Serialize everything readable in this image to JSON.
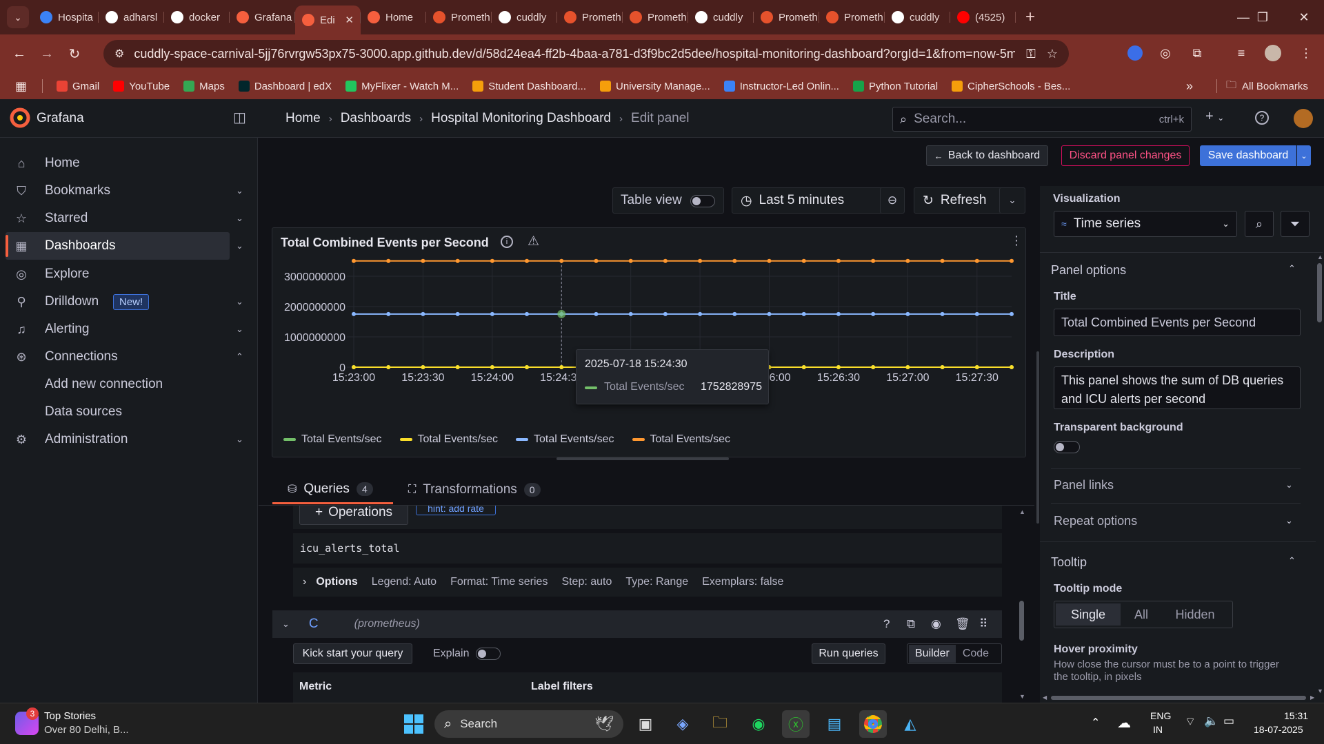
{
  "browser": {
    "tabs": [
      {
        "label": "Hospita",
        "icon": "k-icon",
        "color": "#3b82f6"
      },
      {
        "label": "adharsl",
        "icon": "github-icon",
        "color": "#ffffff"
      },
      {
        "label": "docker",
        "icon": "github-icon",
        "color": "#ffffff"
      },
      {
        "label": "Grafana",
        "icon": "grafana-icon",
        "color": "#f55f3e"
      },
      {
        "label": "Edi",
        "icon": "grafana-icon",
        "color": "#f55f3e",
        "active": true
      },
      {
        "label": "Home",
        "icon": "grafana-icon",
        "color": "#f55f3e"
      },
      {
        "label": "Prometh",
        "icon": "prometheus-icon",
        "color": "#e6522c"
      },
      {
        "label": "cuddly",
        "icon": "github-icon",
        "color": "#ffffff"
      },
      {
        "label": "Prometh",
        "icon": "prometheus-icon",
        "color": "#e6522c"
      },
      {
        "label": "Prometh",
        "icon": "prometheus-icon",
        "color": "#e6522c"
      },
      {
        "label": "cuddly",
        "icon": "github-icon",
        "color": "#ffffff"
      },
      {
        "label": "Prometh",
        "icon": "prometheus-icon",
        "color": "#e6522c"
      },
      {
        "label": "Prometh",
        "icon": "prometheus-icon",
        "color": "#e6522c"
      },
      {
        "label": "cuddly",
        "icon": "github-icon",
        "color": "#ffffff"
      },
      {
        "label": "(4525)",
        "icon": "youtube-icon",
        "color": "#ff0000"
      }
    ],
    "url": "cuddly-space-carnival-5jj76rvrgw53px75-3000.app.github.dev/d/58d24ea4-ff2b-4baa-a781-d3f9bc2d5dee/hospital-monitoring-dashboard?orgId=1&from=now-5m&to...",
    "bookmarks": [
      {
        "label": "Gmail",
        "color": "#ea4335"
      },
      {
        "label": "YouTube",
        "color": "#ff0000"
      },
      {
        "label": "Maps",
        "color": "#34a853"
      },
      {
        "label": "Dashboard | edX",
        "color": "#02262b"
      },
      {
        "label": "MyFlixer - Watch M...",
        "color": "#22c55e"
      },
      {
        "label": "Student Dashboard...",
        "color": "#f59e0b"
      },
      {
        "label": "University Manage...",
        "color": "#f59e0b"
      },
      {
        "label": "Instructor-Led Onlin...",
        "color": "#3b82f6"
      },
      {
        "label": "Python Tutorial",
        "color": "#16a34a"
      },
      {
        "label": "CipherSchools - Bes...",
        "color": "#f59e0b"
      }
    ],
    "all_bookmarks": "All Bookmarks"
  },
  "grafana": {
    "brand": "Grafana",
    "breadcrumb": [
      "Home",
      "Dashboards",
      "Hospital Monitoring Dashboard",
      "Edit panel"
    ],
    "search_placeholder": "Search...",
    "search_shortcut": "ctrl+k",
    "nav": [
      {
        "label": "Home",
        "icon": "home-icon"
      },
      {
        "label": "Bookmarks",
        "icon": "bookmark-icon",
        "chevron": "down"
      },
      {
        "label": "Starred",
        "icon": "star-icon",
        "chevron": "down"
      },
      {
        "label": "Dashboards",
        "icon": "dashboards-icon",
        "chevron": "down",
        "active": true
      },
      {
        "label": "Explore",
        "icon": "compass-icon"
      },
      {
        "label": "Drilldown",
        "icon": "drilldown-icon",
        "chevron": "down",
        "badge": "New!"
      },
      {
        "label": "Alerting",
        "icon": "bell-icon",
        "chevron": "down"
      },
      {
        "label": "Connections",
        "icon": "connections-icon",
        "chevron": "up"
      },
      {
        "label": "Add new connection",
        "sub": true
      },
      {
        "label": "Data sources",
        "sub": true
      },
      {
        "label": "Administration",
        "icon": "gear-icon",
        "chevron": "down"
      }
    ],
    "actions": {
      "back": "Back to dashboard",
      "discard": "Discard panel changes",
      "save": "Save dashboard"
    },
    "toolbar": {
      "table_view": "Table view",
      "time_range": "Last 5 minutes",
      "refresh": "Refresh"
    },
    "panel": {
      "title": "Total Combined Events per Second",
      "tooltip": {
        "time": "2025-07-18 15:24:30",
        "series": "Total Events/sec",
        "value": "1752828975"
      }
    },
    "tabs": {
      "queries": "Queries",
      "queries_count": "4",
      "transformations": "Transformations",
      "transformations_count": "0"
    },
    "query_editor": {
      "operations": "Operations",
      "hint": "hint: add rate",
      "query_text": "icu_alerts_total",
      "options_label": "Options",
      "options_items": [
        "Legend: Auto",
        "Format: Time series",
        "Step: auto",
        "Type: Range",
        "Exemplars: false"
      ],
      "query_c_letter": "C",
      "query_c_source": "(prometheus)",
      "kick_start": "Kick start your query",
      "explain": "Explain",
      "run_queries": "Run queries",
      "builder": "Builder",
      "code": "Code",
      "metric": "Metric",
      "label_filters": "Label filters"
    },
    "options_pane": {
      "visualization_label": "Visualization",
      "visualization": "Time series",
      "panel_options": "Panel options",
      "title_label": "Title",
      "title_value": "Total Combined Events per Second",
      "description_label": "Description",
      "description_value": "This panel shows the sum of DB queries and ICU alerts per second",
      "transparent_label": "Transparent background",
      "panel_links": "Panel links",
      "repeat_options": "Repeat options",
      "tooltip_section": "Tooltip",
      "tooltip_mode_label": "Tooltip mode",
      "tooltip_modes": [
        "Single",
        "All",
        "Hidden"
      ],
      "hover_label": "Hover proximity",
      "hover_desc": "How close the cursor must be to a point to trigger the tooltip, in pixels"
    }
  },
  "chart_data": {
    "type": "line",
    "x": [
      "15:23:00",
      "15:23:15",
      "15:23:30",
      "15:23:45",
      "15:24:00",
      "15:24:15",
      "15:24:30",
      "15:24:45",
      "15:25:00",
      "15:25:15",
      "15:25:30",
      "15:25:45",
      "15:26:00",
      "15:26:15",
      "15:26:30",
      "15:26:45",
      "15:27:00",
      "15:27:15",
      "15:27:30",
      "15:27:45"
    ],
    "x_ticks": [
      "15:23:00",
      "15:23:30",
      "15:24:00",
      "15:24:30",
      "15:25:00",
      "15:25:30",
      "15:26:00",
      "15:26:30",
      "15:27:00",
      "15:27:30"
    ],
    "y_ticks": [
      "0",
      "1000000000",
      "2000000000",
      "3000000000"
    ],
    "ylim": [
      0,
      3500000000
    ],
    "grid": true,
    "legend_placement": "bottom",
    "series": [
      {
        "name": "Total Events/sec",
        "color": "#73bf69",
        "values": [
          0,
          0,
          0,
          0,
          0,
          0,
          0,
          0,
          0,
          0,
          0,
          0,
          0,
          0,
          0,
          0,
          0,
          0,
          0,
          0
        ]
      },
      {
        "name": "Total Events/sec",
        "color": "#fade2a",
        "values": [
          0,
          0,
          0,
          0,
          0,
          0,
          0,
          0,
          0,
          0,
          0,
          0,
          0,
          0,
          0,
          0,
          0,
          0,
          0,
          0
        ]
      },
      {
        "name": "Total Events/sec",
        "color": "#8ab8ff",
        "values": [
          1752828975,
          1752828975,
          1752828975,
          1752828975,
          1752828975,
          1752828975,
          1752828975,
          1752828975,
          1752828975,
          1752828975,
          1752828975,
          1752828975,
          1752828975,
          1752828975,
          1752828975,
          1752828975,
          1752828975,
          1752828975,
          1752828975,
          1752828975
        ]
      },
      {
        "name": "Total Events/sec",
        "color": "#ff9830",
        "values": [
          3505657950,
          3505657950,
          3505657950,
          3505657950,
          3505657950,
          3505657950,
          3505657950,
          3505657950,
          3505657950,
          3505657950,
          3505657950,
          3505657950,
          3505657950,
          3505657950,
          3505657950,
          3505657950,
          3505657950,
          3505657950,
          3505657950,
          3505657950
        ]
      }
    ]
  },
  "taskbar": {
    "news_title": "Top Stories",
    "news_sub": "Over 80 Delhi, B...",
    "news_badge": "3",
    "search": "Search",
    "lang": "ENG",
    "region": "IN",
    "time": "15:31",
    "date": "18-07-2025"
  }
}
